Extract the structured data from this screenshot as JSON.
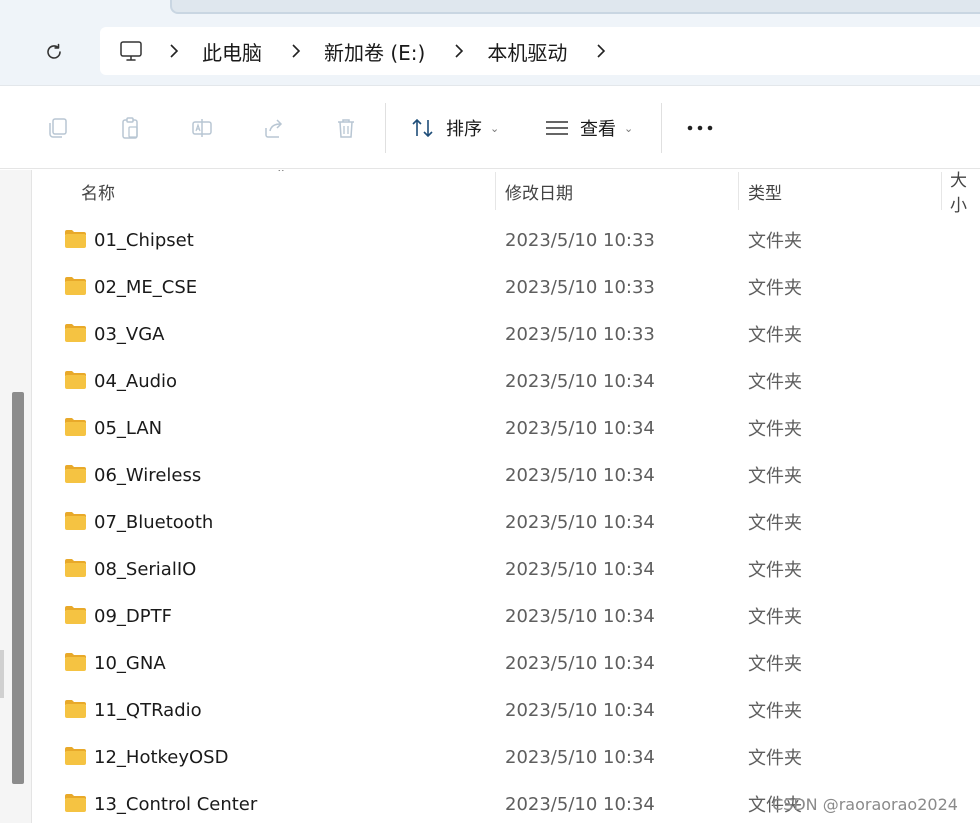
{
  "address_bar": {
    "breadcrumb": [
      "此电脑",
      "新加卷 (E:)",
      "本机驱动"
    ]
  },
  "toolbar": {
    "sort_label": "排序",
    "view_label": "查看"
  },
  "columns": {
    "name": "名称",
    "date": "修改日期",
    "type": "类型",
    "size": "大小"
  },
  "files": [
    {
      "name": "01_Chipset",
      "date": "2023/5/10 10:33",
      "type": "文件夹"
    },
    {
      "name": "02_ME_CSE",
      "date": "2023/5/10 10:33",
      "type": "文件夹"
    },
    {
      "name": "03_VGA",
      "date": "2023/5/10 10:33",
      "type": "文件夹"
    },
    {
      "name": "04_Audio",
      "date": "2023/5/10 10:34",
      "type": "文件夹"
    },
    {
      "name": "05_LAN",
      "date": "2023/5/10 10:34",
      "type": "文件夹"
    },
    {
      "name": "06_Wireless",
      "date": "2023/5/10 10:34",
      "type": "文件夹"
    },
    {
      "name": "07_Bluetooth",
      "date": "2023/5/10 10:34",
      "type": "文件夹"
    },
    {
      "name": "08_SerialIO",
      "date": "2023/5/10 10:34",
      "type": "文件夹"
    },
    {
      "name": "09_DPTF",
      "date": "2023/5/10 10:34",
      "type": "文件夹"
    },
    {
      "name": "10_GNA",
      "date": "2023/5/10 10:34",
      "type": "文件夹"
    },
    {
      "name": "11_QTRadio",
      "date": "2023/5/10 10:34",
      "type": "文件夹"
    },
    {
      "name": "12_HotkeyOSD",
      "date": "2023/5/10 10:34",
      "type": "文件夹"
    },
    {
      "name": "13_Control Center",
      "date": "2023/5/10 10:34",
      "type": "文件夹"
    }
  ],
  "watermark": "CSDN @raoraorao2024",
  "icons": {
    "refresh": "refresh-icon",
    "computer": "computer-icon",
    "copy": "copy-icon",
    "paste": "paste-icon",
    "rename": "rename-icon",
    "share": "share-icon",
    "delete": "delete-icon",
    "sort": "sort-icon",
    "view": "view-icon",
    "more": "more-icon",
    "folder": "folder-icon"
  },
  "colors": {
    "folder_body": "#f5c342",
    "folder_tab": "#e8a92a",
    "toolbar_disabled_icon": "#b8c6d3",
    "scrollbar_thumb": "#8c8c8c"
  }
}
